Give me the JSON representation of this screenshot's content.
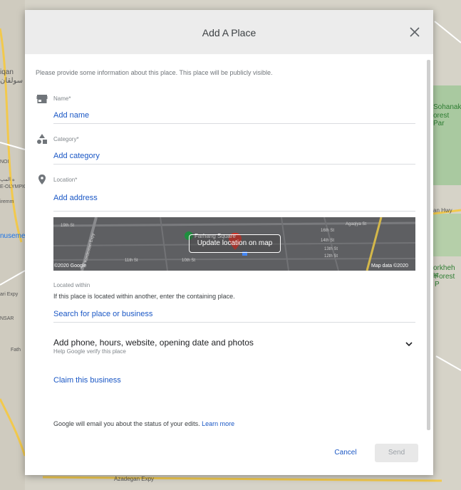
{
  "background": {
    "labels_left": [
      "iqan",
      "سولقان",
      "NOI",
      "ه المپ",
      "E-OLYMPIC",
      "iremm",
      "nusemen",
      "ari Expy",
      "NSAR",
      "Fath"
    ],
    "labels_right": [
      "Sohanak",
      "orest Par",
      "an Hwy",
      "orkheh H",
      "Forest P"
    ],
    "labels_bottom": [
      "Azadegan Expy"
    ]
  },
  "dialog": {
    "title": "Add A Place",
    "close_icon": "close-icon",
    "intro": "Please provide some information about this place. This place will be publicly visible.",
    "fields": {
      "name": {
        "label": "Name*",
        "action": "Add name",
        "icon": "storefront-icon"
      },
      "category": {
        "label": "Category*",
        "action": "Add category",
        "icon": "category-shapes-icon"
      },
      "location": {
        "label": "Location*",
        "action": "Add address",
        "icon": "location-pin-icon"
      }
    },
    "map": {
      "button": "Update location on map",
      "copyright": "©2020 Google",
      "map_data": "Map data ©2020",
      "streets": [
        "19th St",
        "Kordestan Expy",
        "Farhang Square",
        "Agaqiya St",
        "16th St",
        "14th St",
        "13th St",
        "12th St",
        "11th St",
        "10th St"
      ]
    },
    "located_within": {
      "label": "Located within",
      "help": "If this place is located within another, enter the containing place.",
      "action": "Search for place or business"
    },
    "more_details": {
      "title": "Add phone, hours, website, opening date and photos",
      "subtitle": "Help Google verify this place"
    },
    "claim": "Claim this business",
    "notice": "Google will email you about the status of your edits.",
    "learn_more": "Learn more",
    "buttons": {
      "cancel": "Cancel",
      "send": "Send"
    }
  }
}
